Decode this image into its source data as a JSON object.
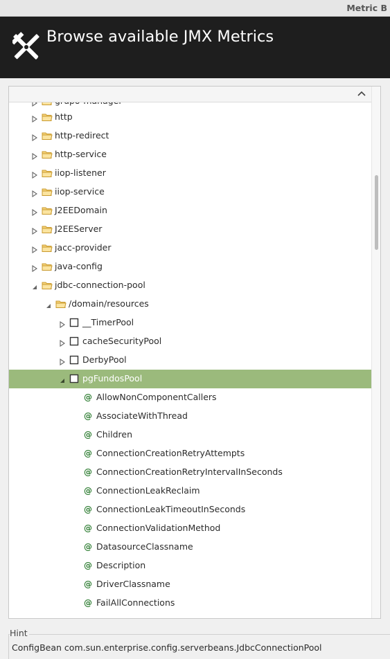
{
  "window": {
    "title": "Metric B"
  },
  "header": {
    "title": "Browse available JMX Metrics",
    "logo_icon": "tools-icon"
  },
  "tree": {
    "clipped_label": "grupo-manager",
    "folders_top": [
      {
        "label": "http",
        "expanded": false
      },
      {
        "label": "http-redirect",
        "expanded": false
      },
      {
        "label": "http-service",
        "expanded": false
      },
      {
        "label": "iiop-listener",
        "expanded": false
      },
      {
        "label": "iiop-service",
        "expanded": false
      },
      {
        "label": "J2EEDomain",
        "expanded": false
      },
      {
        "label": "J2EEServer",
        "expanded": false
      },
      {
        "label": "jacc-provider",
        "expanded": false
      },
      {
        "label": "java-config",
        "expanded": false
      }
    ],
    "jdbc": {
      "label": "jdbc-connection-pool",
      "expanded": true
    },
    "domain": {
      "label": "/domain/resources",
      "expanded": true
    },
    "pools": [
      {
        "label": "__TimerPool",
        "expanded": false
      },
      {
        "label": "cacheSecurityPool",
        "expanded": false
      },
      {
        "label": "DerbyPool",
        "expanded": false
      }
    ],
    "selected": {
      "label": "pgFundosPool",
      "expanded": true
    },
    "attributes": [
      "AllowNonComponentCallers",
      "AssociateWithThread",
      "Children",
      "ConnectionCreationRetryAttempts",
      "ConnectionCreationRetryIntervalInSeconds",
      "ConnectionLeakReclaim",
      "ConnectionLeakTimeoutInSeconds",
      "ConnectionValidationMethod",
      "DatasourceClassname",
      "Description",
      "DriverClassname",
      "FailAllConnections"
    ]
  },
  "hint": {
    "label": "Hint",
    "text": "ConfigBean com.sun.enterprise.config.serverbeans.JdbcConnectionPool"
  },
  "colors": {
    "selection": "#9bba7c",
    "header_bg": "#1e1e1e",
    "attribute_icon": "#2e7d32",
    "folder": "#e8b84a"
  }
}
